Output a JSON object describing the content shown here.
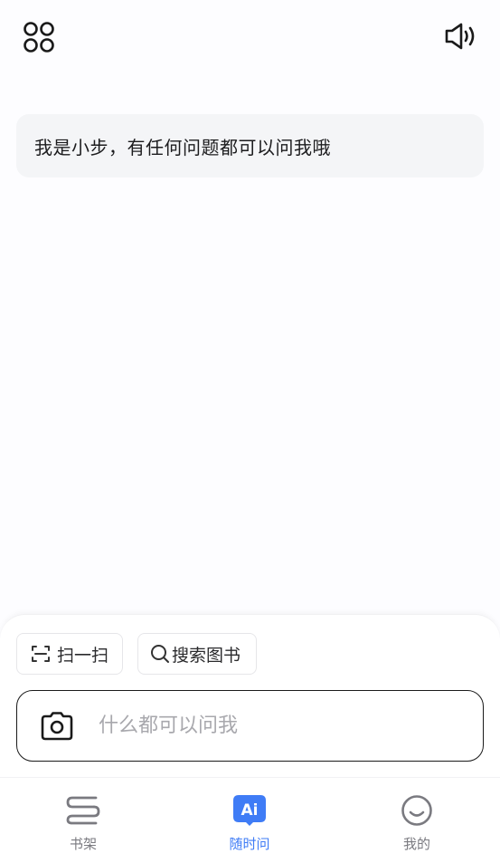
{
  "header": {
    "apps_icon": "grid-apps-icon",
    "speaker_icon": "speaker-icon"
  },
  "chat": {
    "greeting": "我是小步，有任何问题都可以问我哦"
  },
  "quick_actions": [
    {
      "label": "扫一扫",
      "icon": "scan-icon"
    },
    {
      "label": "搜索图书",
      "icon": "search-icon"
    }
  ],
  "composer": {
    "placeholder": "什么都可以问我",
    "camera_icon": "camera-icon"
  },
  "tabs": [
    {
      "label": "书架",
      "icon": "bookshelf-icon",
      "active": false
    },
    {
      "label": "随时问",
      "icon": "ai-icon",
      "icon_text": "Ai",
      "active": true
    },
    {
      "label": "我的",
      "icon": "smile-icon",
      "active": false
    }
  ],
  "colors": {
    "accent": "#3f7cf6",
    "bubble_bg": "#f4f5f7",
    "text": "#1c1c1e",
    "inactive": "#7a7a80"
  }
}
